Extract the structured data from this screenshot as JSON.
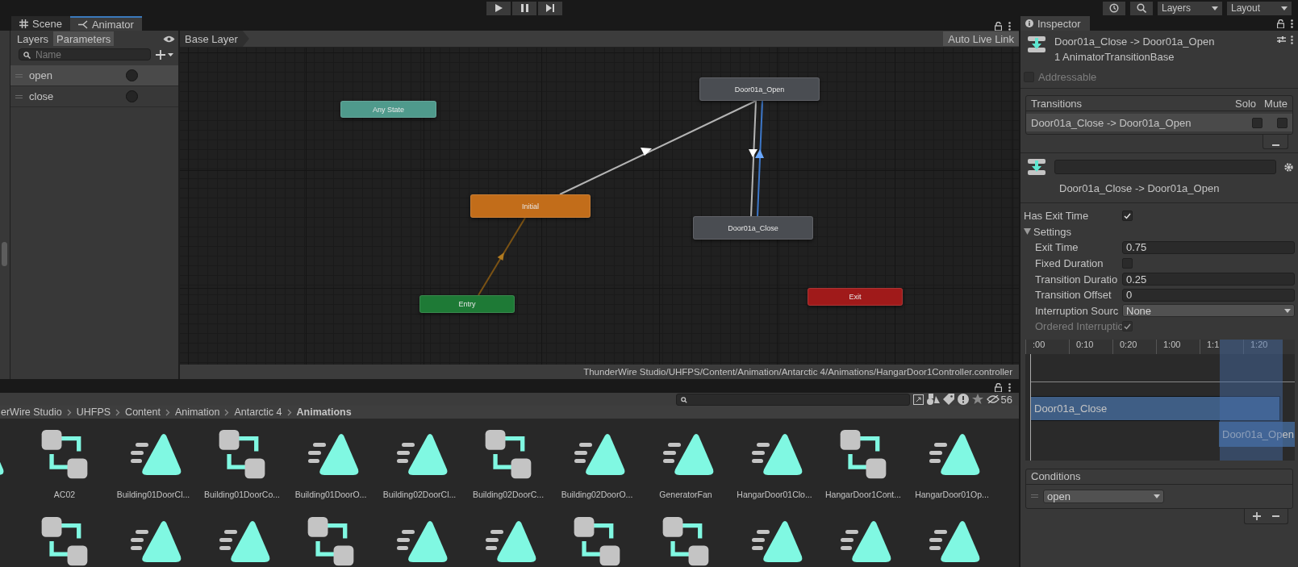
{
  "toolbar": {
    "layers_dropdown": "Layers",
    "layout_dropdown": "Layout"
  },
  "editor_tabs": [
    {
      "label": "Scene",
      "selected": false
    },
    {
      "label": "Animator",
      "selected": true
    }
  ],
  "animator": {
    "panel_tabs": [
      {
        "label": "Layers",
        "selected": false
      },
      {
        "label": "Parameters",
        "selected": true
      }
    ],
    "search": {
      "placeholder": "Name"
    },
    "parameters": [
      {
        "name": "open",
        "selected": true
      },
      {
        "name": "close",
        "selected": false
      }
    ],
    "breadcrumb": "Base Layer",
    "auto_live_link": "Auto Live Link",
    "nodes": [
      {
        "label": "Any State",
        "kind": "any"
      },
      {
        "label": "Door01a_Open",
        "kind": "state"
      },
      {
        "label": "Initial",
        "kind": "default"
      },
      {
        "label": "Door01a_Close",
        "kind": "state"
      },
      {
        "label": "Entry",
        "kind": "entry"
      },
      {
        "label": "Exit",
        "kind": "exit"
      }
    ],
    "status_path": "ThunderWire Studio/UHFPS/Content/Animation/Antarctic 4/Animations/HangarDoor1Controller.controller"
  },
  "project": {
    "hidden_count": "56",
    "breadcrumb": [
      "erWire Studio",
      "UHFPS",
      "Content",
      "Animation",
      "Antarctic 4",
      "Animations"
    ],
    "rows": [
      [
        {
          "kind": "clip"
        },
        {
          "kind": "controller",
          "label": "AC02"
        },
        {
          "kind": "clip",
          "label": "Building01DoorCl..."
        },
        {
          "kind": "controller",
          "label": "Building01DoorCo..."
        },
        {
          "kind": "clip",
          "label": "Building01DoorO..."
        },
        {
          "kind": "clip",
          "label": "Building02DoorCl..."
        },
        {
          "kind": "controller",
          "label": "Building02DoorC..."
        },
        {
          "kind": "clip",
          "label": "Building02DoorO..."
        },
        {
          "kind": "clip",
          "label": "GeneratorFan"
        },
        {
          "kind": "clip",
          "label": "HangarDoor01Clo..."
        },
        {
          "kind": "controller",
          "label": "HangarDoor1Cont..."
        },
        {
          "kind": "clip",
          "label": "HangarDoor01Op..."
        }
      ],
      [
        {
          "kind": "none"
        },
        {
          "kind": "controller"
        },
        {
          "kind": "clip"
        },
        {
          "kind": "clip"
        },
        {
          "kind": "controller"
        },
        {
          "kind": "clip"
        },
        {
          "kind": "clip"
        },
        {
          "kind": "controller"
        },
        {
          "kind": "controller"
        },
        {
          "kind": "clip"
        },
        {
          "kind": "clip"
        },
        {
          "kind": "clip"
        }
      ]
    ]
  },
  "inspector": {
    "tab": "Inspector",
    "title": "Door01a_Close -> Door01a_Open",
    "subtitle": "1 AnimatorTransitionBase",
    "addressable": {
      "label": "Addressable",
      "checked": false
    },
    "transitions": {
      "header": "Transitions",
      "solo_header": "Solo",
      "mute_header": "Mute",
      "rows": [
        {
          "label": "Door01a_Close -> Door01a_Open",
          "solo": false,
          "mute": false,
          "selected": true
        }
      ]
    },
    "caption": "Door01a_Close -> Door01a_Open",
    "properties": [
      {
        "kind": "checkbox",
        "label": "Has Exit Time",
        "checked": true,
        "disabled": false
      },
      {
        "kind": "foldout",
        "label": "Settings",
        "expanded": true,
        "children": [
          {
            "kind": "number",
            "label": "Exit Time",
            "value": "0.75"
          },
          {
            "kind": "checkbox",
            "label": "Fixed Duration",
            "checked": false,
            "disabled": false
          },
          {
            "kind": "number",
            "label": "Transition Duratio",
            "value": "0.25"
          },
          {
            "kind": "number",
            "label": "Transition Offset",
            "value": "0"
          },
          {
            "kind": "dropdown",
            "label": "Interruption Sourc",
            "value": "None"
          },
          {
            "kind": "checkbox",
            "label": "Ordered Interruptio",
            "checked": true,
            "disabled": true
          }
        ]
      }
    ],
    "timeline": {
      "ticks": [
        ":00",
        "0:10",
        "0:20",
        "1:00",
        "1:1",
        "1:20"
      ],
      "clips": [
        "Door01a_Close",
        "Door01a_Open"
      ]
    },
    "conditions": {
      "header": "Conditions",
      "items": [
        {
          "parameter": "open"
        }
      ]
    }
  }
}
